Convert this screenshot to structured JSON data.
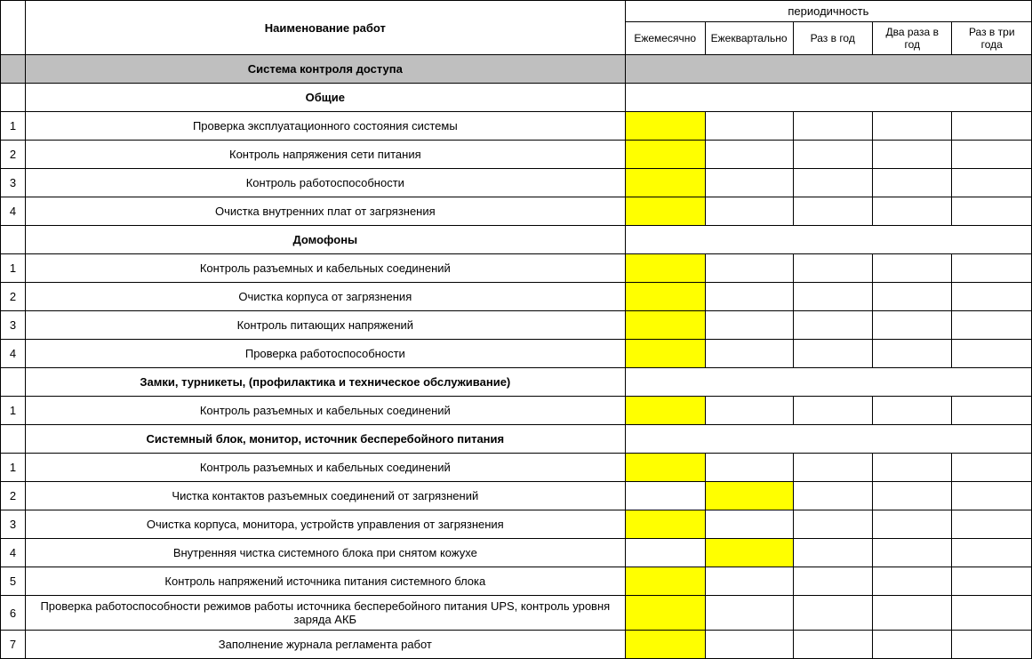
{
  "headers": {
    "name": "Наименование работ",
    "periodicity": "периодичность",
    "periods": [
      "Ежемесячно",
      "Ежеквартально",
      "Раз в год",
      "Два раза в год",
      "Раз в три года"
    ]
  },
  "main_section": "Система контроля доступа",
  "sections": [
    {
      "title": "Общие",
      "rows": [
        {
          "num": "1",
          "name": "Проверка эксплуатационного состояния системы",
          "marks": [
            true,
            false,
            false,
            false,
            false
          ]
        },
        {
          "num": "2",
          "name": "Контроль напряжения сети питания",
          "marks": [
            true,
            false,
            false,
            false,
            false
          ]
        },
        {
          "num": "3",
          "name": "Контроль работоспособности",
          "marks": [
            true,
            false,
            false,
            false,
            false
          ]
        },
        {
          "num": "4",
          "name": "Очистка  внутренних плат от загрязнения",
          "marks": [
            true,
            false,
            false,
            false,
            false
          ]
        }
      ]
    },
    {
      "title": "Домофоны",
      "rows": [
        {
          "num": "1",
          "name": "Контроль разъемных и кабельных соединений",
          "marks": [
            true,
            false,
            false,
            false,
            false
          ]
        },
        {
          "num": "2",
          "name": "Очистка корпуса от загрязнения",
          "marks": [
            true,
            false,
            false,
            false,
            false
          ]
        },
        {
          "num": "3",
          "name": "Контроль питающих напряжений",
          "marks": [
            true,
            false,
            false,
            false,
            false
          ]
        },
        {
          "num": "4",
          "name": "Проверка работоспособности",
          "marks": [
            true,
            false,
            false,
            false,
            false
          ]
        }
      ]
    },
    {
      "title": "Замки, турникеты,  (профилактика и техническое обслуживание)",
      "rows": [
        {
          "num": "1",
          "name": "Контроль разъемных и кабельных соединений",
          "marks": [
            true,
            false,
            false,
            false,
            false
          ]
        }
      ]
    },
    {
      "title": "Системный  блок, монитор, источник бесперебойного питания",
      "rows": [
        {
          "num": "1",
          "name": "Контроль разъемных и кабельных соединений",
          "marks": [
            true,
            false,
            false,
            false,
            false
          ]
        },
        {
          "num": "2",
          "name": "Чистка контактов разъемных соединений от загрязнений",
          "marks": [
            false,
            true,
            false,
            false,
            false
          ]
        },
        {
          "num": "3",
          "name": "Очистка корпуса, монитора, устройств управления от загрязнения",
          "marks": [
            true,
            false,
            false,
            false,
            false
          ]
        },
        {
          "num": "4",
          "name": "Внутренняя чистка системного блока при снятом кожухе",
          "marks": [
            false,
            true,
            false,
            false,
            false
          ]
        },
        {
          "num": "5",
          "name": "Контроль напряжений источника питания системного блока",
          "marks": [
            true,
            false,
            false,
            false,
            false
          ]
        },
        {
          "num": "6",
          "name": "Проверка работоспособности режимов работы источника бесперебойного питания UPS, контроль уровня заряда АКБ",
          "marks": [
            true,
            false,
            false,
            false,
            false
          ]
        },
        {
          "num": "7",
          "name": "Заполнение журнала регламента работ",
          "marks": [
            true,
            false,
            false,
            false,
            false
          ]
        }
      ]
    }
  ]
}
